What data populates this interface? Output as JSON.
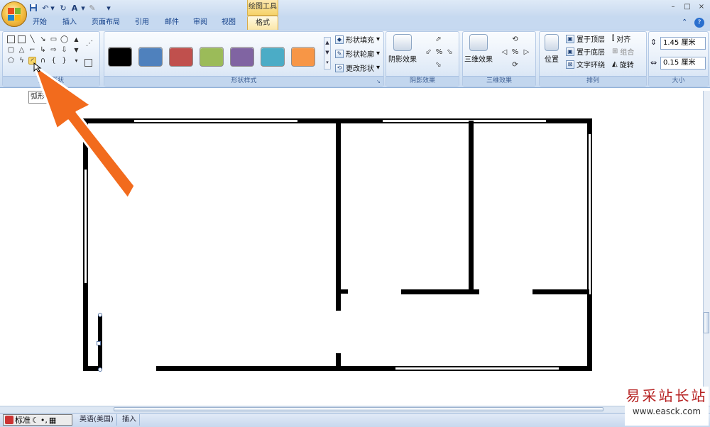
{
  "titlebar": {
    "context_tab_title": "绘图工具",
    "quick_access": {
      "undo_symbol": "↶",
      "redo_symbol": "↻",
      "font_symbol": "A",
      "dropdown_symbol": "▾"
    }
  },
  "window_controls": {
    "minimize": "–",
    "restore": "□",
    "close": "×"
  },
  "tabs": [
    {
      "label": "开始"
    },
    {
      "label": "插入"
    },
    {
      "label": "页面布局"
    },
    {
      "label": "引用"
    },
    {
      "label": "邮件"
    },
    {
      "label": "审阅"
    },
    {
      "label": "视图"
    },
    {
      "label": "格式",
      "active": true
    }
  ],
  "groups": {
    "insert_shapes": {
      "label": "插入形状"
    },
    "shape_styles": {
      "label": "形状样式",
      "swatch_colors": [
        "#000000",
        "#4f81bd",
        "#c0504d",
        "#9bbb59",
        "#8064a2",
        "#4bacc6",
        "#f79646"
      ],
      "fill_label": "形状填充",
      "outline_label": "形状轮廓",
      "change_label": "更改形状"
    },
    "shadow": {
      "label": "阴影效果",
      "button_label": "阴影效果"
    },
    "threed": {
      "label": "三维效果",
      "button_label": "三维效果"
    },
    "arrange": {
      "label": "排列",
      "position_label": "位置",
      "bring_front": "置于顶层",
      "send_back": "置于底层",
      "text_wrap": "文字环绕",
      "align": "对齐",
      "group": "组合",
      "rotate": "旋转"
    },
    "size": {
      "label": "大小",
      "height_value": "1.45 厘米",
      "width_value": "0.15 厘米"
    }
  },
  "tooltip": {
    "text": "弧形"
  },
  "statusbar": {
    "ime_label": "标准",
    "language": "英语(美国)",
    "mode": "插入"
  },
  "watermark": {
    "line1": "易采站长站",
    "line2": "www.easck.com"
  },
  "accent_colors": {
    "arrow": "#f26b1d",
    "ribbon_bg": "#dbe7f5",
    "active_tab": "#fbe7a8"
  }
}
